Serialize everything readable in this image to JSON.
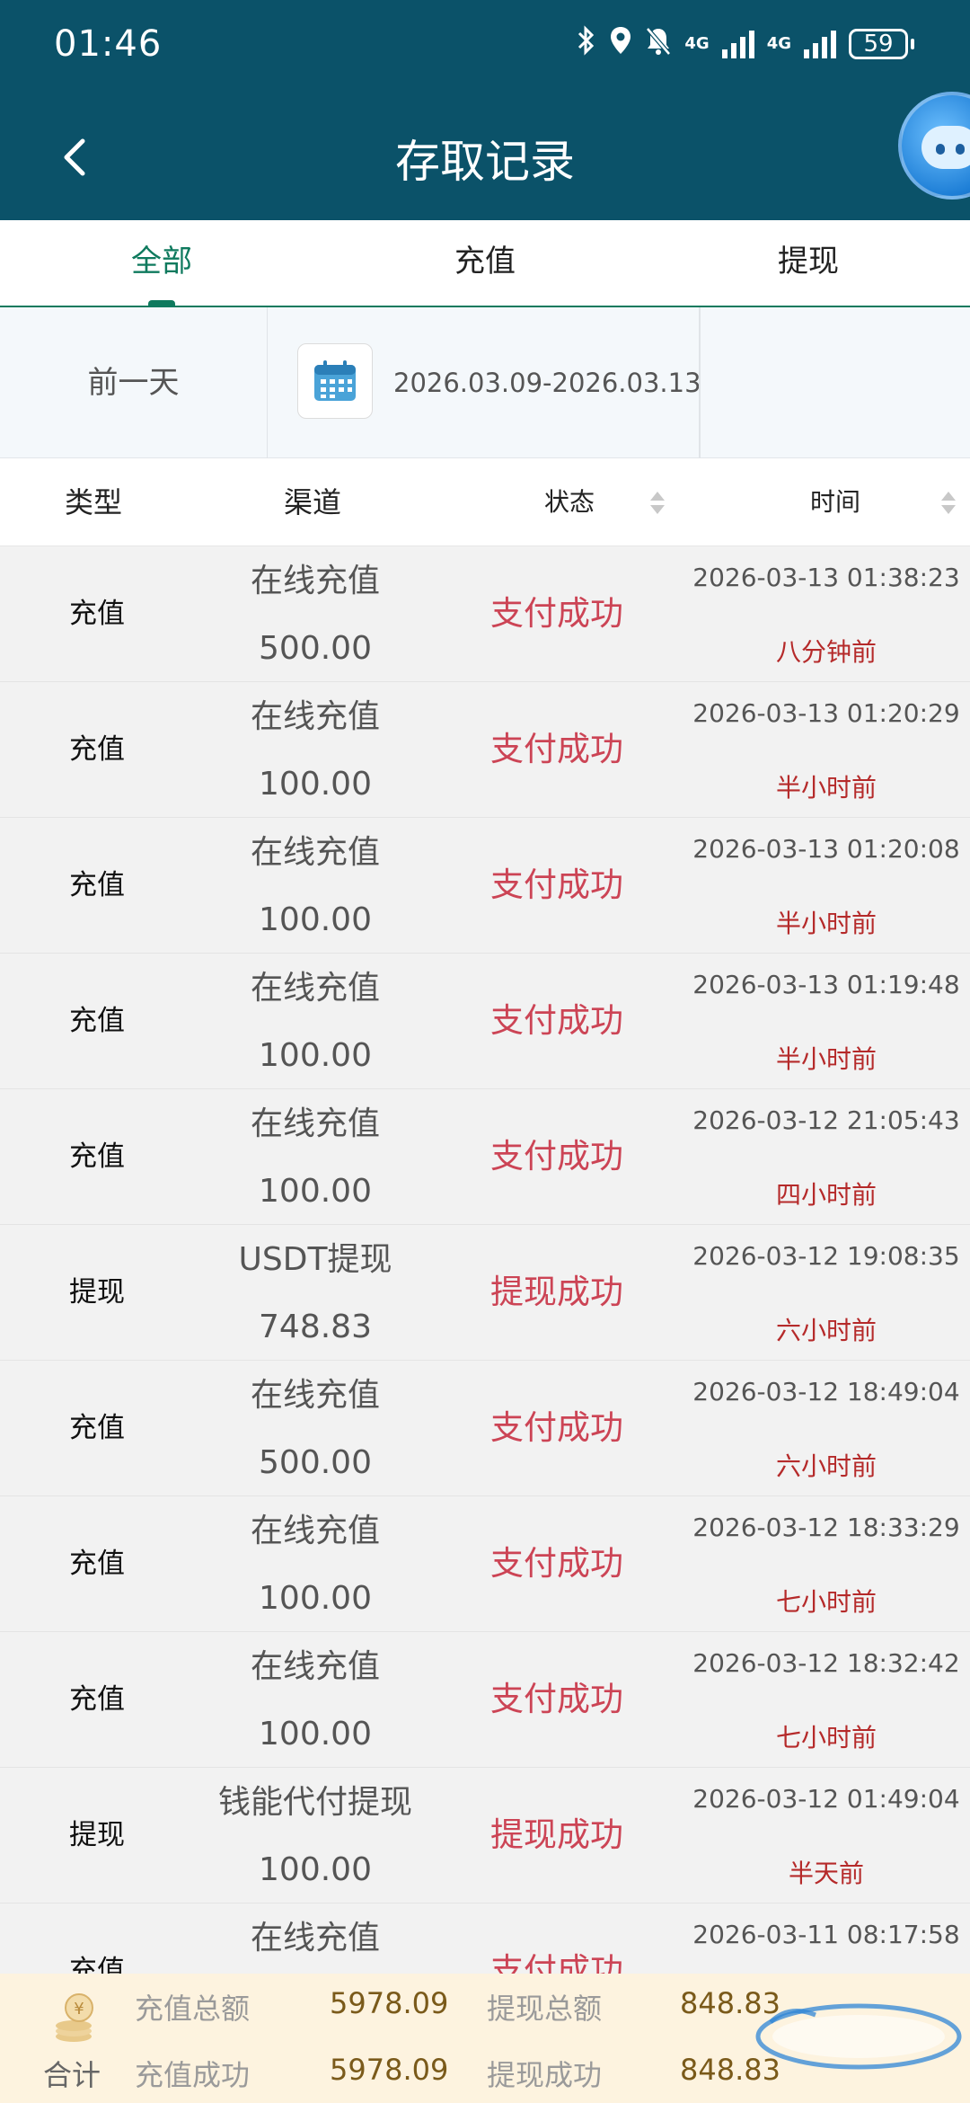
{
  "status_bar": {
    "time": "01:46",
    "net1": "4G",
    "net2": "4G",
    "battery": "59"
  },
  "header": {
    "title": "存取记录"
  },
  "tabs": [
    {
      "label": "全部"
    },
    {
      "label": "充值"
    },
    {
      "label": "提现"
    }
  ],
  "filter": {
    "prev_day": "前一天",
    "date_range": "2026.03.09-2026.03.13"
  },
  "table_header": {
    "type": "类型",
    "channel": "渠道",
    "status": "状态",
    "time": "时间"
  },
  "records": [
    {
      "type": "充值",
      "channel": "在线充值",
      "amount": "500.00",
      "status": "支付成功",
      "time": "2026-03-13 01:38:23",
      "ago": "八分钟前"
    },
    {
      "type": "充值",
      "channel": "在线充值",
      "amount": "100.00",
      "status": "支付成功",
      "time": "2026-03-13 01:20:29",
      "ago": "半小时前"
    },
    {
      "type": "充值",
      "channel": "在线充值",
      "amount": "100.00",
      "status": "支付成功",
      "time": "2026-03-13 01:20:08",
      "ago": "半小时前"
    },
    {
      "type": "充值",
      "channel": "在线充值",
      "amount": "100.00",
      "status": "支付成功",
      "time": "2026-03-13 01:19:48",
      "ago": "半小时前"
    },
    {
      "type": "充值",
      "channel": "在线充值",
      "amount": "100.00",
      "status": "支付成功",
      "time": "2026-03-12 21:05:43",
      "ago": "四小时前"
    },
    {
      "type": "提现",
      "channel": "USDT提现",
      "amount": "748.83",
      "status": "提现成功",
      "time": "2026-03-12 19:08:35",
      "ago": "六小时前"
    },
    {
      "type": "充值",
      "channel": "在线充值",
      "amount": "500.00",
      "status": "支付成功",
      "time": "2026-03-12 18:49:04",
      "ago": "六小时前"
    },
    {
      "type": "充值",
      "channel": "在线充值",
      "amount": "100.00",
      "status": "支付成功",
      "time": "2026-03-12 18:33:29",
      "ago": "七小时前"
    },
    {
      "type": "充值",
      "channel": "在线充值",
      "amount": "100.00",
      "status": "支付成功",
      "time": "2026-03-12 18:32:42",
      "ago": "七小时前"
    },
    {
      "type": "提现",
      "channel": "钱能代付提现",
      "amount": "100.00",
      "status": "提现成功",
      "time": "2026-03-12 01:49:04",
      "ago": "半天前"
    },
    {
      "type": "充值",
      "channel": "在线充值",
      "amount": "",
      "status": "支付成功",
      "time": "2026-03-11 08:17:58",
      "ago": ""
    }
  ],
  "footer": {
    "total_label": "合计",
    "deposit_total_label": "充值总额",
    "deposit_total": "5978.09",
    "withdraw_total_label": "提现总额",
    "withdraw_total": "848.83",
    "deposit_success_label": "充值成功",
    "deposit_success": "5978.09",
    "withdraw_success_label": "提现成功",
    "withdraw_success": "848.83"
  },
  "colors": {
    "header_bg": "#0b5269",
    "accent": "#0f7a5e",
    "status_red": "#cc4455",
    "ago_red": "#b52a2a",
    "footer_bg": "#fdf3df"
  }
}
